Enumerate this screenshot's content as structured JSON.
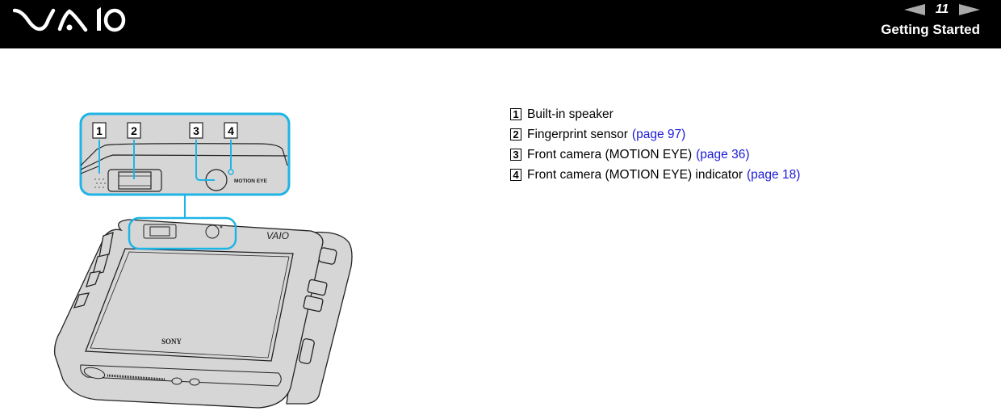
{
  "header": {
    "brand": "VAIO",
    "page_number": "11",
    "section_title": "Getting Started",
    "prev_icon": "left-triangle-arrow",
    "next_icon": "right-triangle-arrow"
  },
  "figure": {
    "callout_labels": [
      "1",
      "2",
      "3",
      "4"
    ],
    "camera_label": "MOTION EYE",
    "device_logo": "VAIO",
    "device_brand": "SONY",
    "accent_color": "#1eb4e6"
  },
  "legend": {
    "items": [
      {
        "num": "1",
        "text": "Built-in speaker",
        "link": ""
      },
      {
        "num": "2",
        "text": "Fingerprint sensor",
        "link": "(page 97)"
      },
      {
        "num": "3",
        "text": "Front camera (MOTION EYE)",
        "link": "(page 36)"
      },
      {
        "num": "4",
        "text": "Front camera (MOTION EYE) indicator",
        "link": "(page 18)"
      }
    ]
  }
}
